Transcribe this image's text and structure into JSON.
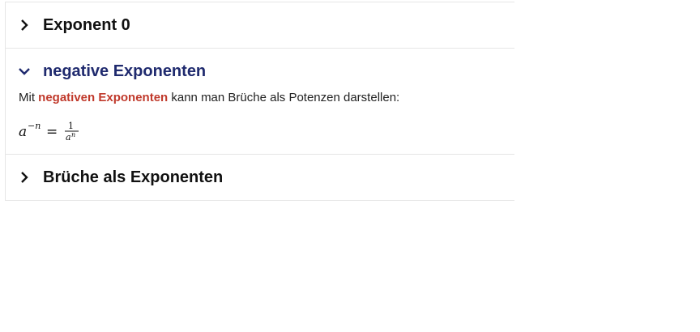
{
  "accordion": {
    "items": [
      {
        "title": "Exponent 0",
        "expanded": false,
        "chevron_icon": "chevron-right-icon"
      },
      {
        "title": "negative Exponenten",
        "expanded": true,
        "chevron_icon": "chevron-down-icon",
        "body": {
          "text_prefix": "Mit ",
          "highlight": "negativen Exponenten",
          "text_suffix": " kann man Brüche als Potenzen darstellen:",
          "formula": {
            "base": "a",
            "exponent": "−n",
            "equals": "=",
            "numerator": "1",
            "denominator_base": "a",
            "denominator_exponent": "n"
          }
        }
      },
      {
        "title": "Brüche als Exponenten",
        "expanded": false,
        "chevron_icon": "chevron-right-icon"
      }
    ]
  },
  "colors": {
    "open_title": "#1f2a6e",
    "highlight": "#c0392b",
    "border": "#e6e6e6"
  }
}
